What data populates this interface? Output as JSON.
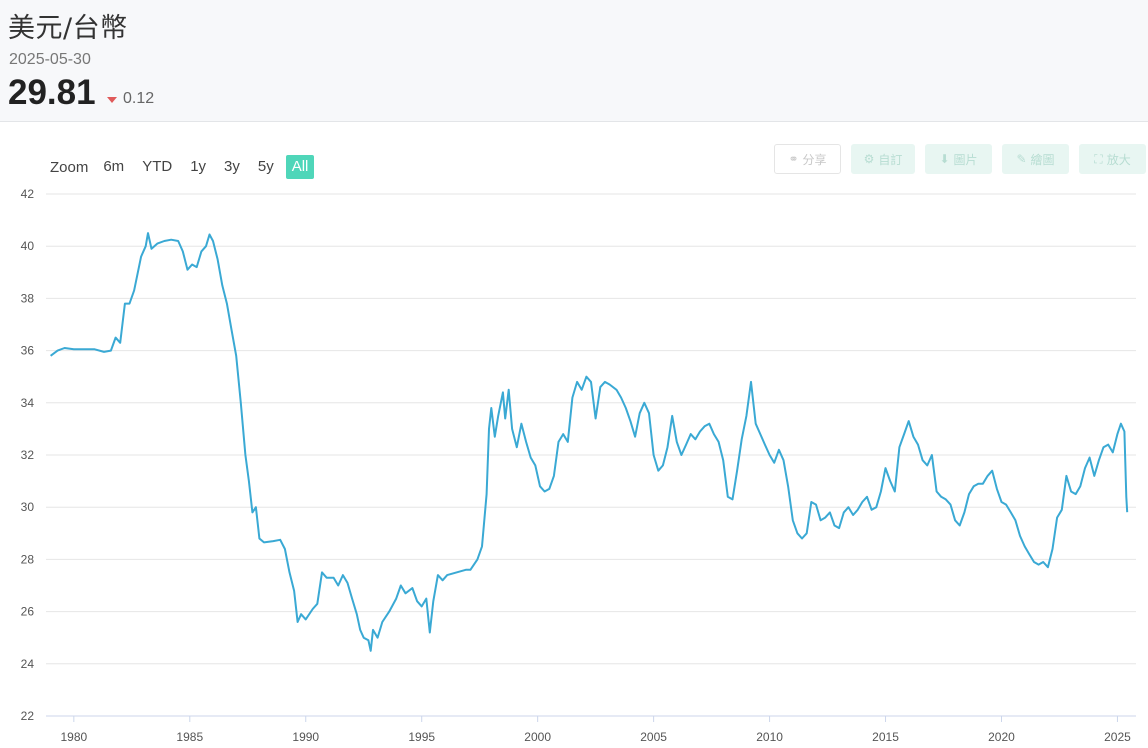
{
  "header": {
    "title": "美元/台幣",
    "date": "2025-05-30",
    "price": "29.81",
    "change": "0.12",
    "change_direction": "down",
    "change_color": "#e05a5a"
  },
  "range_selector": {
    "zoom_label": "Zoom",
    "buttons": [
      "6m",
      "YTD",
      "1y",
      "3y",
      "5y",
      "All"
    ],
    "active": "All",
    "active_color": "#4fd6b9"
  },
  "toolbar": {
    "share": "分享",
    "customize": "自訂",
    "image": "圖片",
    "draw": "繪圖",
    "fullscreen": "放大"
  },
  "chart_data": {
    "type": "line",
    "title": "",
    "xlabel": "",
    "ylabel": "",
    "line_color": "#3aa9d4",
    "grid": true,
    "xlim": [
      1978.8,
      2025.8
    ],
    "ylim": [
      22,
      42
    ],
    "yticks": [
      22,
      24,
      26,
      28,
      30,
      32,
      34,
      36,
      38,
      40,
      42
    ],
    "xticks": [
      1980,
      1985,
      1990,
      1995,
      2000,
      2005,
      2010,
      2015,
      2020,
      2025
    ],
    "series": [
      {
        "points": [
          [
            1979.0,
            35.8
          ],
          [
            1979.3,
            36.0
          ],
          [
            1979.6,
            36.1
          ],
          [
            1980.0,
            36.05
          ],
          [
            1980.5,
            36.05
          ],
          [
            1980.9,
            36.05
          ],
          [
            1981.3,
            35.95
          ],
          [
            1981.6,
            36.0
          ],
          [
            1981.8,
            36.5
          ],
          [
            1982.0,
            36.3
          ],
          [
            1982.2,
            37.8
          ],
          [
            1982.4,
            37.8
          ],
          [
            1982.6,
            38.3
          ],
          [
            1982.9,
            39.6
          ],
          [
            1983.1,
            40.0
          ],
          [
            1983.2,
            40.5
          ],
          [
            1983.35,
            39.9
          ],
          [
            1983.6,
            40.1
          ],
          [
            1983.9,
            40.2
          ],
          [
            1984.2,
            40.25
          ],
          [
            1984.5,
            40.2
          ],
          [
            1984.7,
            39.8
          ],
          [
            1984.9,
            39.1
          ],
          [
            1985.1,
            39.3
          ],
          [
            1985.3,
            39.2
          ],
          [
            1985.5,
            39.8
          ],
          [
            1985.7,
            40.0
          ],
          [
            1985.85,
            40.45
          ],
          [
            1986.0,
            40.2
          ],
          [
            1986.2,
            39.5
          ],
          [
            1986.4,
            38.5
          ],
          [
            1986.6,
            37.8
          ],
          [
            1986.8,
            36.8
          ],
          [
            1987.0,
            35.8
          ],
          [
            1987.2,
            34.0
          ],
          [
            1987.4,
            32.0
          ],
          [
            1987.55,
            31.0
          ],
          [
            1987.7,
            29.8
          ],
          [
            1987.85,
            30.0
          ],
          [
            1988.0,
            28.8
          ],
          [
            1988.2,
            28.65
          ],
          [
            1988.6,
            28.7
          ],
          [
            1988.9,
            28.75
          ],
          [
            1989.1,
            28.4
          ],
          [
            1989.3,
            27.5
          ],
          [
            1989.5,
            26.8
          ],
          [
            1989.65,
            25.6
          ],
          [
            1989.8,
            25.9
          ],
          [
            1990.0,
            25.7
          ],
          [
            1990.3,
            26.1
          ],
          [
            1990.5,
            26.3
          ],
          [
            1990.7,
            27.5
          ],
          [
            1990.9,
            27.3
          ],
          [
            1991.2,
            27.3
          ],
          [
            1991.4,
            27.0
          ],
          [
            1991.6,
            27.4
          ],
          [
            1991.8,
            27.1
          ],
          [
            1992.0,
            26.5
          ],
          [
            1992.2,
            25.9
          ],
          [
            1992.35,
            25.3
          ],
          [
            1992.5,
            25.0
          ],
          [
            1992.7,
            24.9
          ],
          [
            1992.8,
            24.5
          ],
          [
            1992.9,
            25.3
          ],
          [
            1993.1,
            25.0
          ],
          [
            1993.3,
            25.6
          ],
          [
            1993.6,
            26.0
          ],
          [
            1993.9,
            26.5
          ],
          [
            1994.1,
            27.0
          ],
          [
            1994.3,
            26.7
          ],
          [
            1994.6,
            26.9
          ],
          [
            1994.8,
            26.4
          ],
          [
            1995.0,
            26.2
          ],
          [
            1995.2,
            26.5
          ],
          [
            1995.35,
            25.2
          ],
          [
            1995.5,
            26.4
          ],
          [
            1995.7,
            27.4
          ],
          [
            1995.9,
            27.2
          ],
          [
            1996.1,
            27.4
          ],
          [
            1996.5,
            27.5
          ],
          [
            1996.9,
            27.6
          ],
          [
            1997.1,
            27.6
          ],
          [
            1997.4,
            28.0
          ],
          [
            1997.6,
            28.5
          ],
          [
            1997.8,
            30.5
          ],
          [
            1997.9,
            33.0
          ],
          [
            1998.0,
            33.8
          ],
          [
            1998.15,
            32.7
          ],
          [
            1998.3,
            33.5
          ],
          [
            1998.5,
            34.4
          ],
          [
            1998.6,
            33.4
          ],
          [
            1998.75,
            34.5
          ],
          [
            1998.9,
            33.0
          ],
          [
            1999.1,
            32.3
          ],
          [
            1999.3,
            33.2
          ],
          [
            1999.5,
            32.5
          ],
          [
            1999.7,
            31.9
          ],
          [
            1999.9,
            31.6
          ],
          [
            2000.1,
            30.8
          ],
          [
            2000.3,
            30.6
          ],
          [
            2000.5,
            30.7
          ],
          [
            2000.7,
            31.2
          ],
          [
            2000.9,
            32.5
          ],
          [
            2001.1,
            32.8
          ],
          [
            2001.3,
            32.5
          ],
          [
            2001.5,
            34.2
          ],
          [
            2001.7,
            34.8
          ],
          [
            2001.9,
            34.5
          ],
          [
            2002.1,
            35.0
          ],
          [
            2002.3,
            34.8
          ],
          [
            2002.5,
            33.4
          ],
          [
            2002.7,
            34.6
          ],
          [
            2002.9,
            34.8
          ],
          [
            2003.1,
            34.7
          ],
          [
            2003.4,
            34.5
          ],
          [
            2003.6,
            34.2
          ],
          [
            2003.8,
            33.8
          ],
          [
            2004.0,
            33.3
          ],
          [
            2004.2,
            32.7
          ],
          [
            2004.4,
            33.6
          ],
          [
            2004.6,
            34.0
          ],
          [
            2004.8,
            33.6
          ],
          [
            2005.0,
            32.0
          ],
          [
            2005.2,
            31.4
          ],
          [
            2005.4,
            31.6
          ],
          [
            2005.6,
            32.3
          ],
          [
            2005.8,
            33.5
          ],
          [
            2006.0,
            32.5
          ],
          [
            2006.2,
            32.0
          ],
          [
            2006.4,
            32.4
          ],
          [
            2006.6,
            32.8
          ],
          [
            2006.8,
            32.6
          ],
          [
            2007.0,
            32.9
          ],
          [
            2007.2,
            33.1
          ],
          [
            2007.4,
            33.2
          ],
          [
            2007.6,
            32.8
          ],
          [
            2007.8,
            32.5
          ],
          [
            2008.0,
            31.8
          ],
          [
            2008.2,
            30.4
          ],
          [
            2008.4,
            30.3
          ],
          [
            2008.6,
            31.4
          ],
          [
            2008.8,
            32.6
          ],
          [
            2009.0,
            33.5
          ],
          [
            2009.2,
            34.8
          ],
          [
            2009.4,
            33.2
          ],
          [
            2009.6,
            32.8
          ],
          [
            2009.8,
            32.4
          ],
          [
            2010.0,
            32.0
          ],
          [
            2010.2,
            31.7
          ],
          [
            2010.4,
            32.2
          ],
          [
            2010.6,
            31.8
          ],
          [
            2010.8,
            30.8
          ],
          [
            2011.0,
            29.5
          ],
          [
            2011.2,
            29.0
          ],
          [
            2011.4,
            28.8
          ],
          [
            2011.6,
            29.0
          ],
          [
            2011.8,
            30.2
          ],
          [
            2012.0,
            30.1
          ],
          [
            2012.2,
            29.5
          ],
          [
            2012.4,
            29.6
          ],
          [
            2012.6,
            29.8
          ],
          [
            2012.8,
            29.3
          ],
          [
            2013.0,
            29.2
          ],
          [
            2013.2,
            29.8
          ],
          [
            2013.4,
            30.0
          ],
          [
            2013.6,
            29.7
          ],
          [
            2013.8,
            29.9
          ],
          [
            2014.0,
            30.2
          ],
          [
            2014.2,
            30.4
          ],
          [
            2014.4,
            29.9
          ],
          [
            2014.6,
            30.0
          ],
          [
            2014.8,
            30.6
          ],
          [
            2015.0,
            31.5
          ],
          [
            2015.2,
            31.0
          ],
          [
            2015.4,
            30.6
          ],
          [
            2015.6,
            32.3
          ],
          [
            2015.8,
            32.8
          ],
          [
            2016.0,
            33.3
          ],
          [
            2016.2,
            32.7
          ],
          [
            2016.4,
            32.4
          ],
          [
            2016.6,
            31.8
          ],
          [
            2016.8,
            31.6
          ],
          [
            2017.0,
            32.0
          ],
          [
            2017.2,
            30.6
          ],
          [
            2017.4,
            30.4
          ],
          [
            2017.6,
            30.3
          ],
          [
            2017.8,
            30.1
          ],
          [
            2018.0,
            29.5
          ],
          [
            2018.2,
            29.3
          ],
          [
            2018.4,
            29.8
          ],
          [
            2018.6,
            30.5
          ],
          [
            2018.8,
            30.8
          ],
          [
            2019.0,
            30.9
          ],
          [
            2019.2,
            30.9
          ],
          [
            2019.4,
            31.2
          ],
          [
            2019.6,
            31.4
          ],
          [
            2019.8,
            30.7
          ],
          [
            2020.0,
            30.2
          ],
          [
            2020.2,
            30.1
          ],
          [
            2020.4,
            29.8
          ],
          [
            2020.6,
            29.5
          ],
          [
            2020.8,
            28.9
          ],
          [
            2021.0,
            28.5
          ],
          [
            2021.2,
            28.2
          ],
          [
            2021.4,
            27.9
          ],
          [
            2021.6,
            27.8
          ],
          [
            2021.8,
            27.9
          ],
          [
            2022.0,
            27.7
          ],
          [
            2022.2,
            28.4
          ],
          [
            2022.4,
            29.6
          ],
          [
            2022.6,
            29.9
          ],
          [
            2022.8,
            31.2
          ],
          [
            2023.0,
            30.6
          ],
          [
            2023.2,
            30.5
          ],
          [
            2023.4,
            30.8
          ],
          [
            2023.6,
            31.5
          ],
          [
            2023.8,
            31.9
          ],
          [
            2024.0,
            31.2
          ],
          [
            2024.2,
            31.8
          ],
          [
            2024.4,
            32.3
          ],
          [
            2024.6,
            32.4
          ],
          [
            2024.8,
            32.1
          ],
          [
            2025.0,
            32.8
          ],
          [
            2025.15,
            33.2
          ],
          [
            2025.3,
            32.9
          ],
          [
            2025.38,
            30.4
          ],
          [
            2025.42,
            29.81
          ]
        ]
      }
    ]
  }
}
